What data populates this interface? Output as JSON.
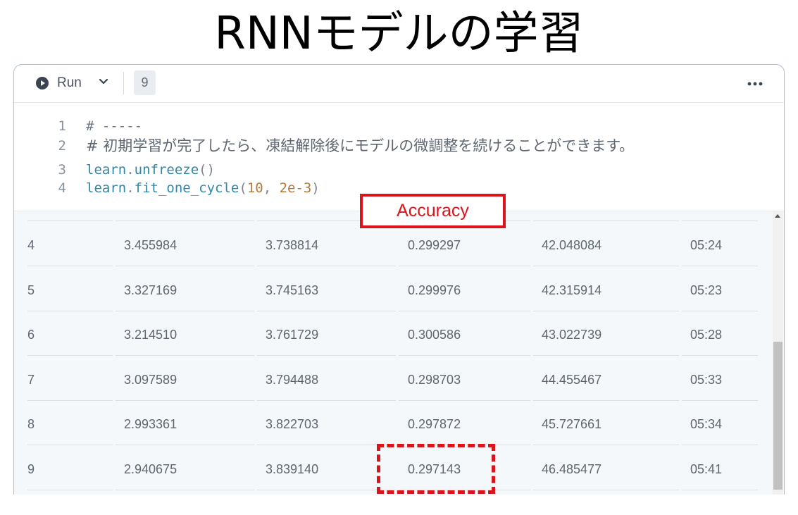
{
  "slide_title": "RNNモデルの学習",
  "toolbar": {
    "run_label": "Run",
    "execution_count": "9",
    "icons": [
      "play-circle-icon",
      "chevron-down-icon",
      "more-horizontal-icon"
    ]
  },
  "code": {
    "lines": [
      {
        "num": "1",
        "text": "# -----"
      },
      {
        "num": "2",
        "text": "# 初期学習が完了したら、凍結解除後にモデルの微調整を続けることができます。"
      },
      {
        "num": "3",
        "obj": "learn",
        "method": "unfreeze",
        "args": "()"
      },
      {
        "num": "4",
        "obj": "learn",
        "method": "fit_one_cycle",
        "arg1": "10",
        "sep": ", ",
        "arg2": "2e-3",
        "close": ")"
      }
    ]
  },
  "annotation": {
    "label": "Accuracy",
    "color": "#d9151b"
  },
  "results": {
    "rows": [
      [
        "4",
        "3.455984",
        "3.738814",
        "0.299297",
        "42.048084",
        "05:24"
      ],
      [
        "5",
        "3.327169",
        "3.745163",
        "0.299976",
        "42.315914",
        "05:23"
      ],
      [
        "6",
        "3.214510",
        "3.761729",
        "0.300586",
        "43.022739",
        "05:28"
      ],
      [
        "7",
        "3.097589",
        "3.794488",
        "0.298703",
        "44.455467",
        "05:33"
      ],
      [
        "8",
        "2.993361",
        "3.822703",
        "0.297872",
        "45.727661",
        "05:34"
      ],
      [
        "9",
        "2.940675",
        "3.839140",
        "0.297143",
        "46.485477",
        "05:41"
      ]
    ]
  }
}
